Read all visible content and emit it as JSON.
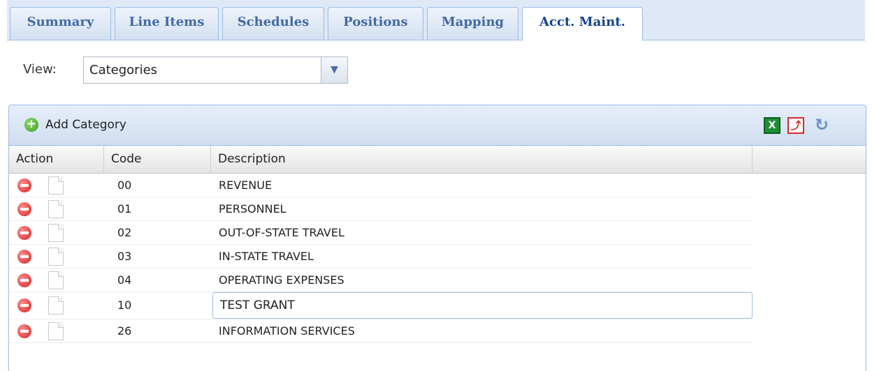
{
  "tabs": [
    {
      "label": "Summary",
      "active": false
    },
    {
      "label": "Line Items",
      "active": false
    },
    {
      "label": "Schedules",
      "active": false
    },
    {
      "label": "Positions",
      "active": false
    },
    {
      "label": "Mapping",
      "active": false
    },
    {
      "label": "Acct. Maint.",
      "active": true
    }
  ],
  "view": {
    "label": "View:",
    "selected": "Categories"
  },
  "toolbar": {
    "add_label": "Add Category",
    "icons": [
      "excel-export-icon",
      "pdf-export-icon",
      "refresh-icon"
    ]
  },
  "grid": {
    "columns": [
      "Action",
      "Code",
      "Description"
    ],
    "rows": [
      {
        "code": "00",
        "description": "REVENUE"
      },
      {
        "code": "01",
        "description": "PERSONNEL"
      },
      {
        "code": "02",
        "description": "OUT-OF-STATE TRAVEL"
      },
      {
        "code": "03",
        "description": "IN-STATE TRAVEL"
      },
      {
        "code": "04",
        "description": "OPERATING EXPENSES"
      },
      {
        "code": "10",
        "description": "TEST GRANT",
        "editing": true
      },
      {
        "code": "26",
        "description": "INFORMATION SERVICES"
      }
    ]
  },
  "colors": {
    "tab_text": "#416aa3",
    "panel_border": "#99bbe8",
    "delete_icon": "#d42020",
    "add_icon": "#3f9a23"
  }
}
